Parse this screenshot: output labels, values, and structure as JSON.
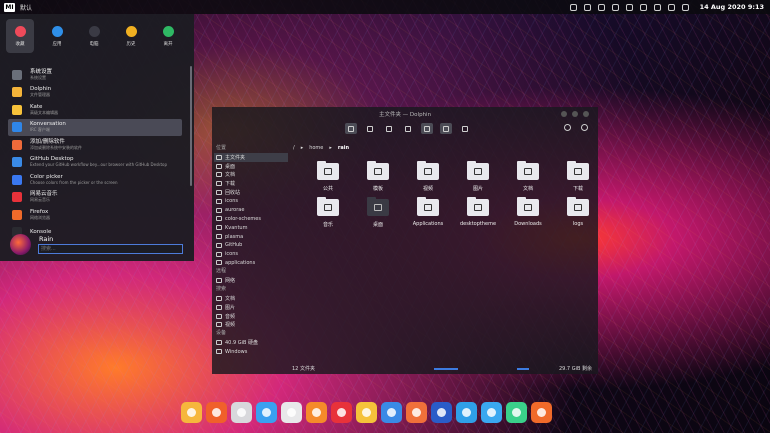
{
  "topbar": {
    "logo": "MI",
    "desktop_label": "默认",
    "clock": "14 Aug 2020 9:13",
    "tray_icons": [
      "notification-icon",
      "bell-icon",
      "clipboard-icon",
      "battery-icon",
      "bluetooth-icon",
      "wifi-icon",
      "display-icon",
      "volume-icon",
      "network-icon"
    ]
  },
  "launcher": {
    "categories": [
      {
        "label": "收藏",
        "color": "#ef4a5a",
        "active": true
      },
      {
        "label": "应用",
        "color": "#2f8fe8",
        "active": false
      },
      {
        "label": "电脑",
        "color": "#3a3a44",
        "active": false
      },
      {
        "label": "历史",
        "color": "#f1b021",
        "active": false
      },
      {
        "label": "离开",
        "color": "#2fb864",
        "active": false
      }
    ],
    "apps": [
      {
        "name": "系统设置",
        "desc": "系统设置",
        "color": "#6a6f7a"
      },
      {
        "name": "Dolphin",
        "desc": "文件管理器",
        "color": "#f4b43a"
      },
      {
        "name": "Kate",
        "desc": "高级文本编辑器",
        "color": "#f7c23a"
      },
      {
        "name": "Konversation",
        "desc": "IRC 客户端",
        "color": "#2f86e8"
      },
      {
        "name": "添加/删除软件",
        "desc": "添加或删除系统中安装的软件",
        "color": "#ef6a3a"
      },
      {
        "name": "GitHub Desktop",
        "desc": "Extend your GitHub workflow bey...our browser with GitHub Desktop",
        "color": "#3a8ae6"
      },
      {
        "name": "Color picker",
        "desc": "Choose colors from the picker or the screen",
        "color": "#3a78f0"
      },
      {
        "name": "网易云音乐",
        "desc": "网易云音乐",
        "color": "#e8323a"
      },
      {
        "name": "Firefox",
        "desc": "网络浏览器",
        "color": "#f06a2a"
      },
      {
        "name": "Konsole",
        "desc": "",
        "color": "#2a2a30"
      }
    ],
    "user": "Rain",
    "search_placeholder": "搜索..."
  },
  "dolphin": {
    "title": "主文件夹 — Dolphin",
    "sidebar": [
      {
        "type": "section",
        "text": "位置"
      },
      {
        "type": "place",
        "text": "主文件夹",
        "selected": true
      },
      {
        "type": "place",
        "text": "桌面"
      },
      {
        "type": "place",
        "text": "文档"
      },
      {
        "type": "place",
        "text": "下载"
      },
      {
        "type": "place",
        "text": "回收站"
      },
      {
        "type": "place",
        "text": "icons"
      },
      {
        "type": "place",
        "text": "aurorae"
      },
      {
        "type": "place",
        "text": "color-schemes"
      },
      {
        "type": "place",
        "text": "Kvantum"
      },
      {
        "type": "place",
        "text": "plasma"
      },
      {
        "type": "place",
        "text": "GitHub"
      },
      {
        "type": "place",
        "text": "icons"
      },
      {
        "type": "place",
        "text": "applications"
      },
      {
        "type": "section",
        "text": "远程"
      },
      {
        "type": "place",
        "text": "网络"
      },
      {
        "type": "section",
        "text": "搜索"
      },
      {
        "type": "place",
        "text": "文档"
      },
      {
        "type": "place",
        "text": "图片"
      },
      {
        "type": "place",
        "text": "音频"
      },
      {
        "type": "place",
        "text": "视频"
      },
      {
        "type": "section",
        "text": "设备"
      },
      {
        "type": "place",
        "text": "40.9 GiB 硬盘"
      },
      {
        "type": "place",
        "text": "Windows"
      }
    ],
    "breadcrumb": [
      "/",
      "home",
      "rain"
    ],
    "files": [
      {
        "name": "公共",
        "dark": false
      },
      {
        "name": "模板",
        "dark": false
      },
      {
        "name": "视频",
        "dark": false
      },
      {
        "name": "图片",
        "dark": false
      },
      {
        "name": "文档",
        "dark": false
      },
      {
        "name": "下载",
        "dark": false
      },
      {
        "name": "音乐",
        "dark": false
      },
      {
        "name": "桌面",
        "dark": true
      },
      {
        "name": "Applications",
        "dark": false
      },
      {
        "name": "desktoptheme",
        "dark": false
      },
      {
        "name": "Downloads",
        "dark": false
      },
      {
        "name": "logs",
        "dark": false
      }
    ],
    "status_count": "12 文件夹",
    "status_free": "29.7 GiB 剩余"
  },
  "dock": [
    {
      "name": "files-icon",
      "color": "#f6b73c"
    },
    {
      "name": "firefox-icon",
      "color": "#f0602a"
    },
    {
      "name": "chrome-icon",
      "color": "#d8d8dc"
    },
    {
      "name": "qq-icon",
      "color": "#3aa0f0"
    },
    {
      "name": "inkscape-icon",
      "color": "#e8e8ea"
    },
    {
      "name": "menu-app-icon",
      "color": "#f58a2a"
    },
    {
      "name": "netease-music-icon",
      "color": "#e8323a"
    },
    {
      "name": "notes-icon",
      "color": "#f5c23a"
    },
    {
      "name": "github-icon",
      "color": "#3a8ae6"
    },
    {
      "name": "store-icon",
      "color": "#f0703a"
    },
    {
      "name": "word-icon",
      "color": "#2a5cc8"
    },
    {
      "name": "edge-icon",
      "color": "#2f9fe8"
    },
    {
      "name": "cloud-icon",
      "color": "#3aa8f0"
    },
    {
      "name": "music-icon",
      "color": "#3ad08a"
    },
    {
      "name": "video-icon",
      "color": "#f06a2a"
    }
  ]
}
